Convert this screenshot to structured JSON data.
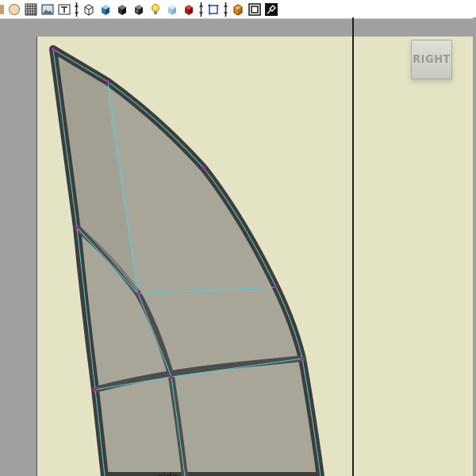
{
  "toolbar": {
    "buttons": [
      {
        "icon": "sphere-icon"
      },
      {
        "icon": "grid-icon"
      },
      {
        "icon": "image-plane-icon"
      },
      {
        "icon": "text-icon"
      },
      {
        "icon": "wireframe-cube-icon"
      },
      {
        "icon": "shaded-cube-icon"
      },
      {
        "icon": "smooth-shaded-icon"
      },
      {
        "icon": "textured-icon"
      },
      {
        "icon": "light-icon"
      },
      {
        "icon": "xray-icon"
      },
      {
        "icon": "red-cube-icon"
      },
      {
        "icon": "isolate-select-icon"
      },
      {
        "icon": "camera-cube-icon"
      },
      {
        "icon": "resolution-gate-icon"
      },
      {
        "icon": "tool-settings-icon"
      }
    ]
  },
  "viewport_right": {
    "viewcube_label": "RIGHT"
  },
  "viewport_left": {
    "object_label": "side"
  },
  "colors": {
    "viewport_bg": "#e4e4c4",
    "mesh_fill": "#a7a699",
    "mesh_edge": "#4f4d4b",
    "wire_cyan": "#3fd6e6",
    "vertex_magenta": "#c21bb5"
  }
}
